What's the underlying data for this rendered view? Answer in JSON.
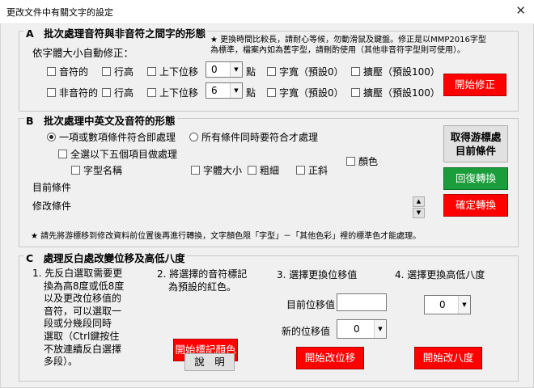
{
  "window": {
    "title": "更改文件中有關文字的設定",
    "close_glyph": "✕"
  },
  "section_a": {
    "title": "A　批次處理音符與非音符之間字的形態",
    "subtitle": "依字體大小自動修正：",
    "note_line1": "★ 更換時間比較長，請耐心等候，勿動滑鼠及鍵盤。修正是以MMP2016字型",
    "note_line2": "為標準，檔案內如為舊字型，請刪酌使用（其他非音符字型則可使用）。",
    "row1": {
      "label": "音符的",
      "line_height": "行高",
      "offset": "上下位移",
      "offset_value": "0",
      "unit": "點",
      "width": "字寬（預設0）",
      "scale": "擴壓（預設100）"
    },
    "row2": {
      "label": "非音符的",
      "line_height": "行高",
      "offset": "上下位移",
      "offset_value": "6",
      "unit": "點",
      "width": "字寬（預設0）",
      "scale": "擴壓（預設100）"
    },
    "start_button": "開始修正"
  },
  "section_b": {
    "title": "B　批次處理中英文及音符的形態",
    "radio_any": "一項或數項條件符合即處理",
    "radio_all": "所有條件同時要符合才處理",
    "select_all": "全選以下五個項目做處理",
    "font_name": "字型名稱",
    "font_size": "字體大小",
    "bold": "粗細",
    "italic": "正斜",
    "color": "顏色",
    "current_conditions": "目前條件",
    "modify_conditions": "修改條件",
    "get_cursor_button_line1": "取得游標處",
    "get_cursor_button_line2": "目前條件",
    "restore_button": "回復轉換",
    "confirm_button": "確定轉換",
    "footnote": "★ 請先將游標移到修改資料前位置後再進行轉換，文字顏色限「字型」－「其他色彩」裡的標準色才能處理。"
  },
  "section_c": {
    "title": "C　處理反白處改變位移及高低八度",
    "step1": [
      "1. 先反白選取需要更",
      "換為高8度或低8度",
      "以及更改位移值的",
      "音符，可以選取一",
      "段或分幾段同時",
      "選取（Ctrl鍵按住",
      "不放連續反白選擇",
      "多段）。"
    ],
    "step2": [
      "2. 將選擇的音符標記",
      "為預設的紅色。"
    ],
    "mark_button": "開始標記顏色",
    "help_button": "說　明",
    "step3": "3. 選擇更換位移值",
    "current_offset_label": "目前位移值",
    "current_offset_value": "",
    "new_offset_label": "新的位移值",
    "new_offset_value": "0",
    "start_offset_button": "開始改位移",
    "step4": "4. 選擇更換高低八度",
    "octave_value": "0",
    "start_octave_button": "開始改八度"
  },
  "icons": {
    "checkbox": "checkbox-icon",
    "radio": "radio-icon",
    "dropdown": "chevron-down-icon",
    "spin_up": "triangle-up-icon",
    "spin_down": "triangle-down-icon"
  }
}
